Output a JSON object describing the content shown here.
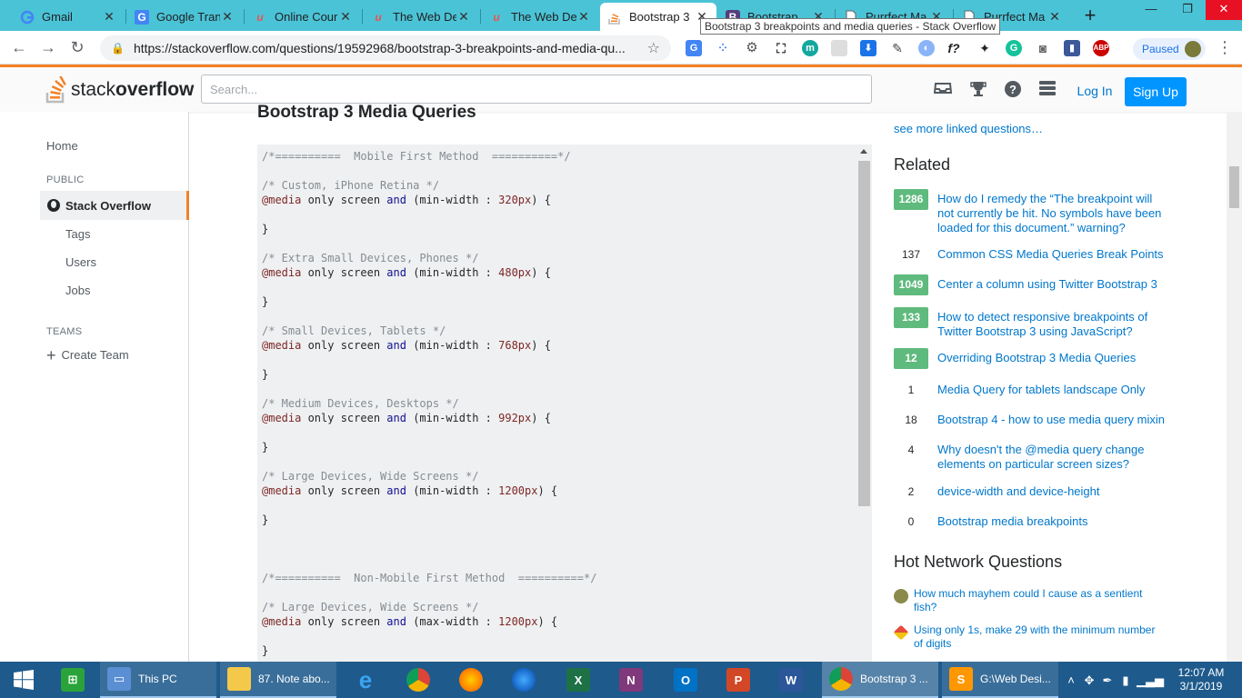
{
  "browser": {
    "tabs": [
      {
        "title": "Gmail",
        "favicon": "google-g",
        "active": false
      },
      {
        "title": "Google Tran",
        "favicon": "translate",
        "active": false
      },
      {
        "title": "Online Cour",
        "favicon": "udemy",
        "active": false
      },
      {
        "title": "The Web De",
        "favicon": "udemy",
        "active": false
      },
      {
        "title": "The Web De",
        "favicon": "udemy",
        "active": false
      },
      {
        "title": "Bootstrap 3",
        "favicon": "stackoverflow",
        "active": true
      },
      {
        "title": "Bootstrap",
        "favicon": "bootstrap-b",
        "active": false
      },
      {
        "title": "Purrfect Ma",
        "favicon": "doc",
        "active": false
      },
      {
        "title": "Purrfect Ma",
        "favicon": "doc",
        "active": false
      }
    ],
    "tooltip": "Bootstrap 3 breakpoints and media queries - Stack Overflow",
    "url": "https://stackoverflow.com/questions/19592968/bootstrap-3-breakpoints-and-media-qu...",
    "profile_status": "Paused",
    "colors": {
      "tab_strip": "#4bc3d6",
      "accent": "#f48024",
      "link": "#0077cc",
      "answered": "#5fba7d"
    }
  },
  "so_header": {
    "logo_light": "stack",
    "logo_bold": "overflow",
    "search_placeholder": "Search...",
    "login_label": "Log In",
    "signup_label": "Sign Up"
  },
  "left_nav": {
    "home": "Home",
    "public_label": "PUBLIC",
    "stack_overflow": "Stack Overflow",
    "tags": "Tags",
    "users": "Users",
    "jobs": "Jobs",
    "teams_label": "TEAMS",
    "create_team": "Create Team"
  },
  "main": {
    "heading": "Bootstrap 3 Media Queries"
  },
  "right": {
    "see_more": "see more linked questions…",
    "related_title": "Related",
    "related": [
      {
        "score": "1286",
        "answered": true,
        "title": "How do I remedy the “The breakpoint will not currently be hit. No symbols have been loaded for this document.” warning?"
      },
      {
        "score": "137",
        "answered": false,
        "title": "Common CSS Media Queries Break Points"
      },
      {
        "score": "1049",
        "answered": true,
        "title": "Center a column using Twitter Bootstrap 3"
      },
      {
        "score": "133",
        "answered": true,
        "title": "How to detect responsive breakpoints of Twitter Bootstrap 3 using JavaScript?"
      },
      {
        "score": "12",
        "answered": true,
        "title": "Overriding Bootstrap 3 Media Queries"
      },
      {
        "score": "1",
        "answered": false,
        "title": "Media Query for tablets landscape Only"
      },
      {
        "score": "18",
        "answered": false,
        "title": "Bootstrap 4 - how to use media query mixin"
      },
      {
        "score": "4",
        "answered": false,
        "title": "Why doesn't the @media query change elements on particular screen sizes?"
      },
      {
        "score": "2",
        "answered": false,
        "title": "device-width and device-height"
      },
      {
        "score": "0",
        "answered": false,
        "title": "Bootstrap media breakpoints"
      }
    ],
    "hot_title": "Hot Network Questions",
    "hot": [
      {
        "title": "How much mayhem could I cause as a sentient fish?",
        "icon": "worldbuilding-icon"
      },
      {
        "title": "Using only 1s, make 29 with the minimum number of digits",
        "icon": "puzzling-icon"
      }
    ]
  },
  "taskbar": {
    "apps": [
      {
        "label": "This PC",
        "icon": "this-pc-icon"
      },
      {
        "label": "87. Note abo...",
        "icon": "folder-icon"
      },
      {
        "label": "Bootstrap 3 ...",
        "icon": "chrome-icon"
      },
      {
        "label": "G:\\Web Desi...",
        "icon": "sublime-icon"
      }
    ],
    "time": "12:07 AM",
    "date": "3/1/2019"
  }
}
